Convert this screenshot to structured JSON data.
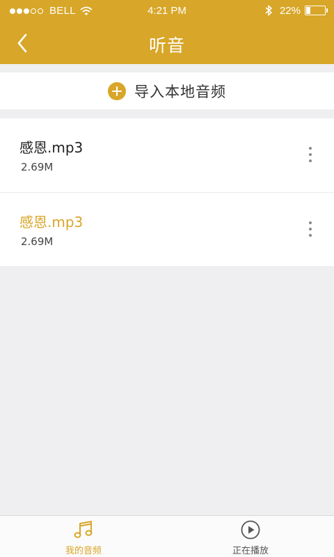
{
  "status_bar": {
    "carrier": "BELL",
    "time": "4:21 PM",
    "battery_percent": "22%",
    "battery_level": 0.22,
    "signal_bars_filled": 3,
    "signal_bars_total": 5
  },
  "nav": {
    "title": "听音",
    "back_icon": "chevron-left-icon"
  },
  "import": {
    "label": "导入本地音频",
    "icon": "plus-circle-icon"
  },
  "audio_items": [
    {
      "name": "感恩.mp3",
      "size": "2.69M",
      "active": false
    },
    {
      "name": "感恩.mp3",
      "size": "2.69M",
      "active": true
    }
  ],
  "tabs": [
    {
      "label": "我的音频",
      "icon": "music-note-icon",
      "active": true
    },
    {
      "label": "正在播放",
      "icon": "play-circle-icon",
      "active": false
    }
  ],
  "colors": {
    "accent": "#d8a628",
    "background": "#efeef0"
  }
}
